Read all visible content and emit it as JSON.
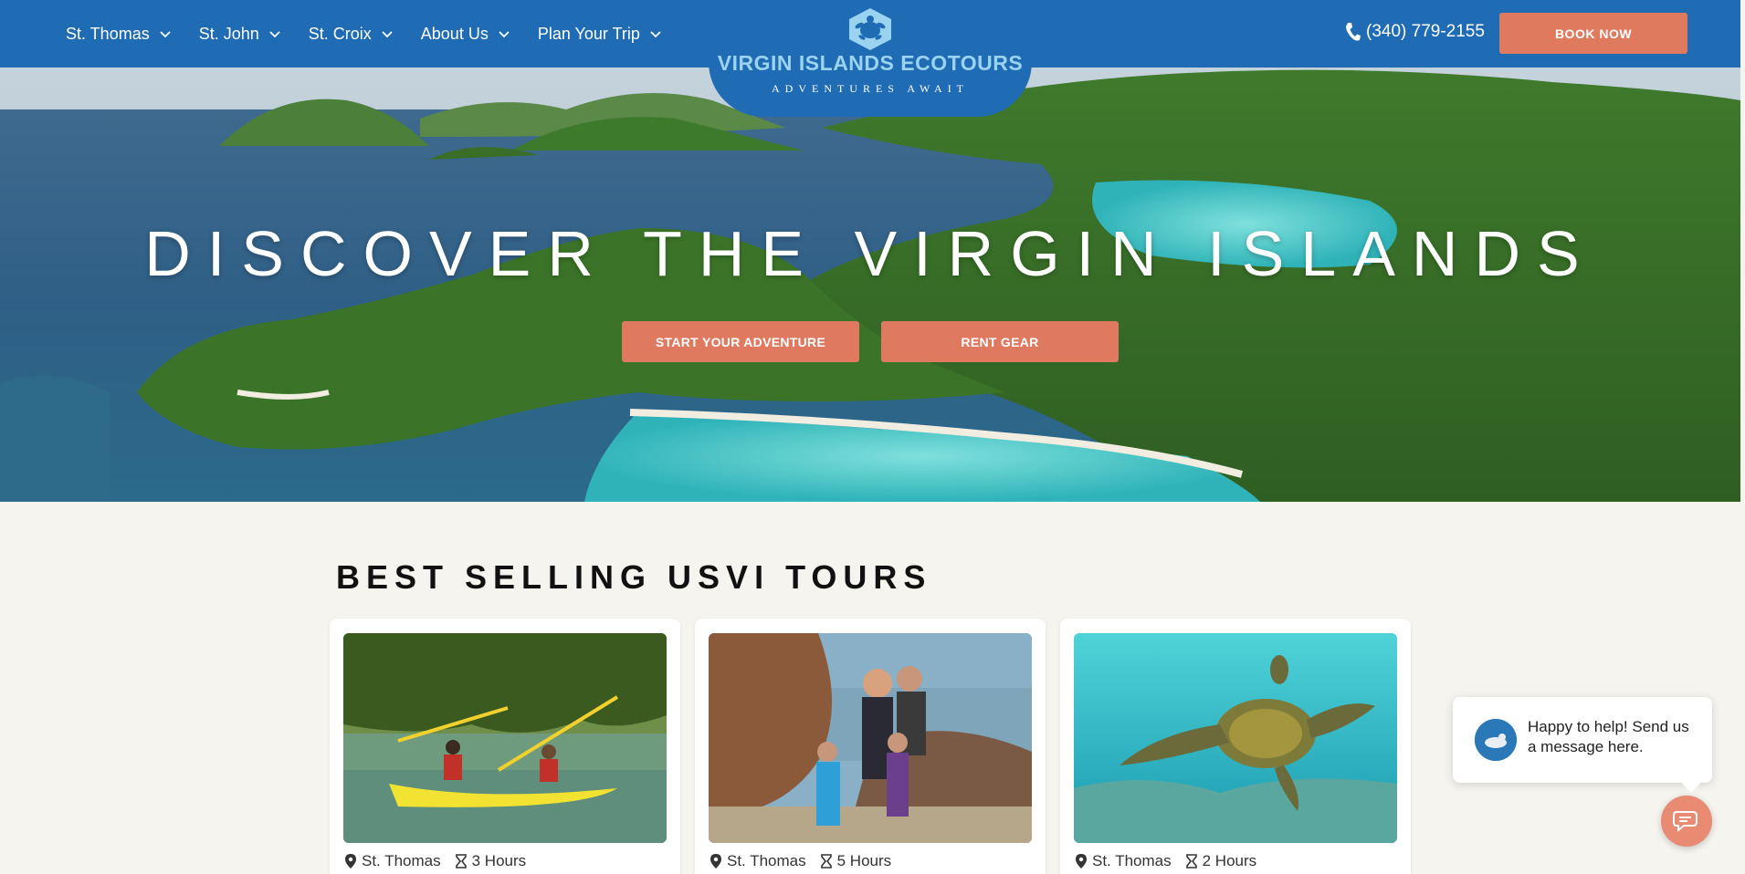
{
  "nav": {
    "items": [
      {
        "label": "St. Thomas"
      },
      {
        "label": "St. John"
      },
      {
        "label": "St. Croix"
      },
      {
        "label": "About Us"
      },
      {
        "label": "Plan Your Trip"
      }
    ],
    "logo_name": "VIRGIN ISLANDS ECOTOURS",
    "logo_tagline": "ADVENTURES AWAIT",
    "phone": "(340) 779-2155",
    "book_label": "BOOK NOW"
  },
  "hero": {
    "title": "DISCOVER THE VIRGIN ISLANDS",
    "primary_button": "START YOUR ADVENTURE",
    "secondary_button": "RENT GEAR"
  },
  "tours": {
    "heading_bold": "BEST SELLING",
    "heading_rest": "USVI TOURS",
    "cards": [
      {
        "location": "St. Thomas",
        "duration": "3 Hours",
        "image": "kayak-photo"
      },
      {
        "location": "St. Thomas",
        "duration": "5 Hours",
        "image": "family-beach-photo"
      },
      {
        "location": "St. Thomas",
        "duration": "2 Hours",
        "image": "sea-turtle-photo"
      }
    ]
  },
  "chat": {
    "message": "Happy to help! Send us a message here."
  },
  "colors": {
    "nav_blue": "#1f6cb5",
    "accent_coral": "#e07a5f",
    "logo_light_blue": "#9ad3ef",
    "page_bg": "#f6f4ef"
  }
}
